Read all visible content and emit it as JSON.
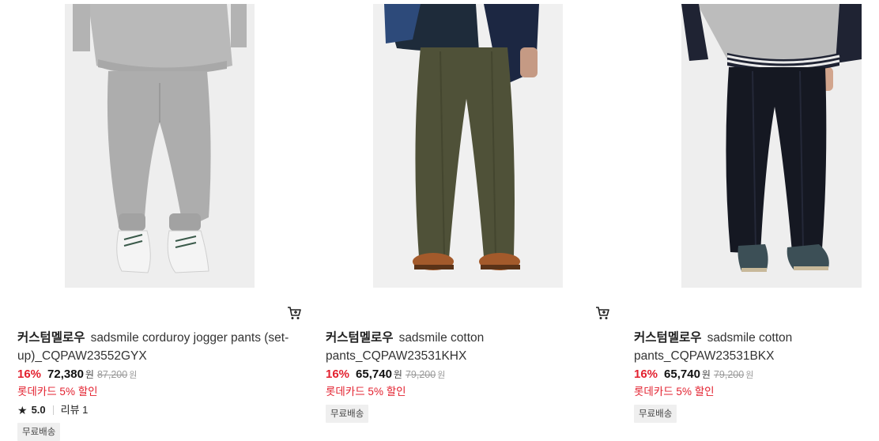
{
  "products": [
    {
      "brand": "커스텀멜로우",
      "name": "sadsmile corduroy jogger pants (set-up)_CQPAW23552GYX",
      "discount": "16%",
      "price": "72,380",
      "currency": "원",
      "original_price": "87,200",
      "original_currency": "원",
      "promo": "롯데카드 5% 할인",
      "rating": "5.0",
      "reviews": "리뷰 1",
      "badge": "무료배송",
      "image_alt": "grey jogger pants"
    },
    {
      "brand": "커스텀멜로우",
      "name": "sadsmile cotton pants_CQPAW23531KHX",
      "discount": "16%",
      "price": "65,740",
      "currency": "원",
      "original_price": "79,200",
      "original_currency": "원",
      "promo": "롯데카드 5% 할인",
      "badge": "무료배송",
      "image_alt": "khaki cotton pants"
    },
    {
      "brand": "커스텀멜로우",
      "name": "sadsmile cotton pants_CQPAW23531BKX",
      "discount": "16%",
      "price": "65,740",
      "currency": "원",
      "original_price": "79,200",
      "original_currency": "원",
      "promo": "롯데카드 5% 할인",
      "badge": "무료배송",
      "image_alt": "black cotton pants"
    }
  ],
  "icons": {
    "cart": "cart-icon",
    "star": "star-icon"
  },
  "colors": {
    "discount": "#e3212f",
    "badge_bg": "#efefef"
  }
}
